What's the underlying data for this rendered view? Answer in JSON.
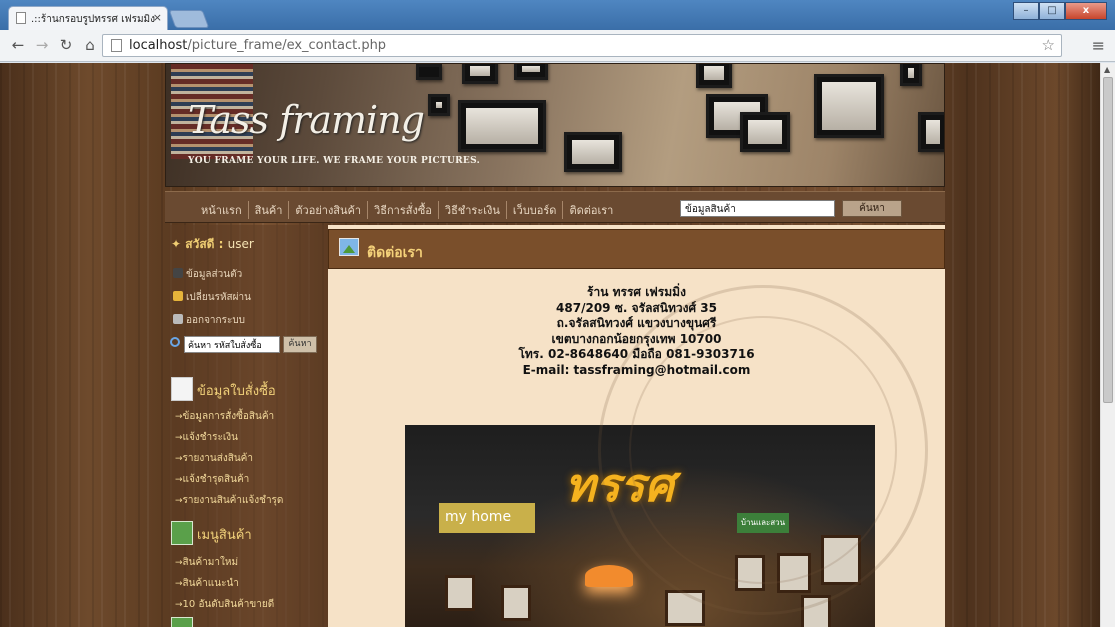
{
  "browser": {
    "tab_title": ".::ร้านกรอบรูปทรรศ เฟรมมิง",
    "tab_close": "×",
    "url_host": "localhost",
    "url_path": "/picture_frame/ex_contact.php",
    "win_min": "–",
    "win_max": "□",
    "win_close": "x"
  },
  "banner": {
    "logo_text": "Tass framing",
    "slogan": "YOU FRAME YOUR LIFE. WE FRAME YOUR PICTURES."
  },
  "nav": {
    "items": [
      "หน้าแรก",
      "สินค้า",
      "ตัวอย่างสินค้า",
      "วิธีการสั่งซื้อ",
      "วิธีชำระเงิน",
      "เว็บบอร์ด",
      "ติดต่อเรา"
    ],
    "search_value": "ข้อมูลสินค้า",
    "search_button": "ค้นหา"
  },
  "sidebar": {
    "greeting": "สวัสดี :",
    "username": "user",
    "account_links": [
      "ข้อมูลส่วนตัว",
      "เปลี่ยนรหัสผ่าน",
      "ออกจากระบบ"
    ],
    "order_search_placeholder": "ค้นหา รหัสใบสั่งซื้อ",
    "order_search_button": "ค้นหา",
    "orders_title": "ข้อมูลใบสั่งซื้อ",
    "orders_links": [
      "ข้อมูลการสั่งซื้อสินค้า",
      "แจ้งชำระเงิน",
      "รายงานส่งสินค้า",
      "แจ้งชำรุดสินค้า",
      "รายงานสินค้าแจ้งชำรุด"
    ],
    "menu_title": "เมนูสินค้า",
    "menu_links": [
      "สินค้ามาใหม่",
      "สินค้าแนะนำ",
      "10 อันดับสินค้าขายดี"
    ]
  },
  "content": {
    "title": "ติดต่อเรา",
    "address_lines": [
      "ร้าน ทรรศ เฟรมมิ่ง",
      "487/209 ซ. จรัลสนิทวงศ์ 35",
      "ถ.จรัลสนิทวงศ์ แขวงบางขุนศรี",
      "เขตบางกอกน้อยกรุงเทพ 10700",
      "โทร. 02-8648640 มือถือ 081-9303716",
      "E-mail: tassframing@hotmail.com"
    ],
    "photo_sign_main": "ทรรศ",
    "photo_sign_myhome": "my home",
    "photo_sign_small": "บ้านและสวน"
  },
  "colors": {
    "nav_bg": "#6a4a31",
    "content_bg": "#f6e2c7",
    "content_head_bg": "#7a4f2b",
    "accent_gold": "#f5d27a"
  }
}
